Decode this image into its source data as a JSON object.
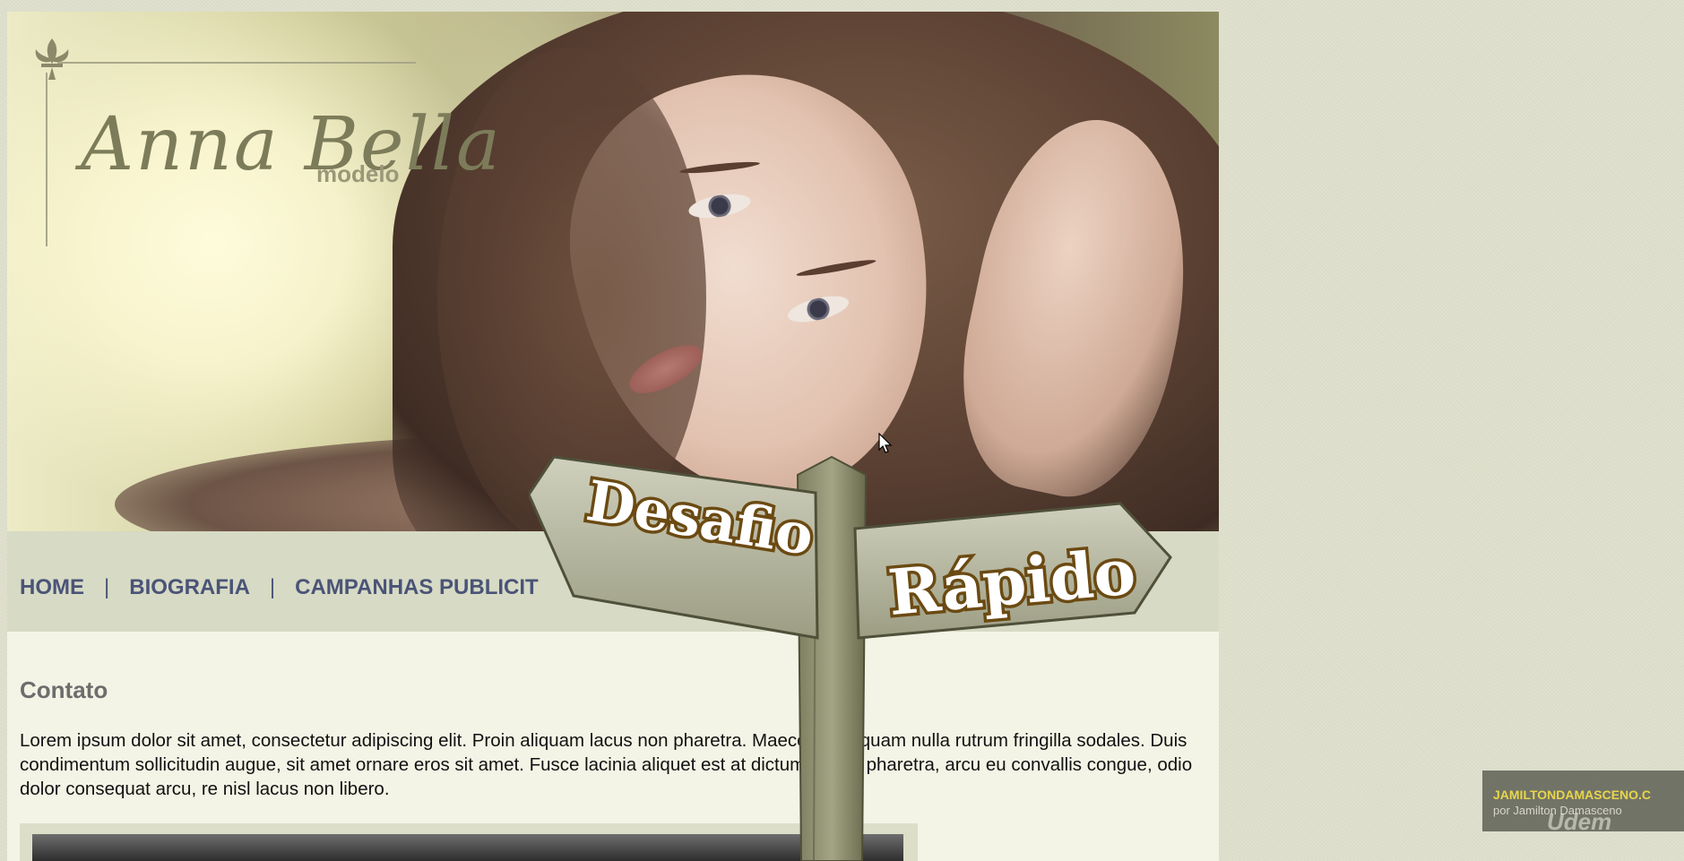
{
  "logo": {
    "name": "Anna Bella",
    "subtitle": "modelo"
  },
  "nav": {
    "items": [
      "HOME",
      "|",
      "BIOGRAFIA",
      "|",
      "CAMPANHAS PUBLICIT"
    ]
  },
  "content": {
    "title": "Contato",
    "paragraph": "Lorem ipsum dolor sit amet, consectetur adipiscing elit. Proin aliquam lacus non pharetra. Maecenas aliquam nulla rutrum fringilla sodales. Duis condimentum sollicitudin augue, sit amet ornare eros sit amet. Fusce lacinia aliquet est at dictum. Morbi pharetra, arcu eu convallis congue, odio dolor consequat arcu, re nisl lacus non libero."
  },
  "signpost": {
    "left": "Desafio",
    "right": "Rápido"
  },
  "watermark": {
    "line1": "JAMILTONDAMASCENO.C",
    "line2": "por Jamilton Damasceno",
    "brand": "Udem"
  },
  "colors": {
    "nav_text": "#4a5478",
    "nav_bar": "#d7dac4",
    "page_bg": "#f4f4e6",
    "logo": "#7d7c5a",
    "sign_text_stroke": "#6b4a12"
  },
  "icons": {
    "logo_ornament": "fleur-de-lis-icon",
    "pointer": "mouse-cursor-icon"
  }
}
